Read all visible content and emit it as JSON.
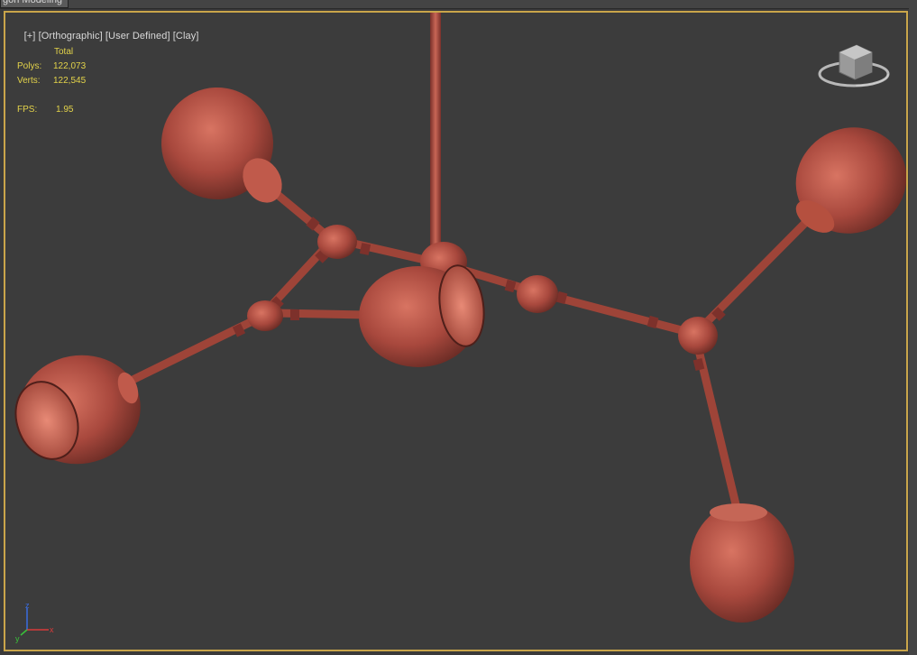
{
  "top_tab": {
    "label": "gon Modeling"
  },
  "viewport": {
    "labels": {
      "menu": "[+]",
      "view": "[Orthographic]",
      "camera": "[User Defined]",
      "shading": "[Clay]"
    },
    "border_color": "#c9a54a",
    "stats": {
      "header": "Total",
      "polys_label": "Polys:",
      "polys_value": "122,073",
      "verts_label": "Verts:",
      "verts_value": "122,545",
      "fps_label": "FPS:",
      "fps_value": "1.95"
    },
    "gizmo": {
      "axis_x": "x",
      "axis_y": "y",
      "axis_z": "z"
    },
    "viewcube_icon": "viewcube-icon"
  },
  "model": {
    "material_color": "#b84a3e",
    "shades": 5
  }
}
